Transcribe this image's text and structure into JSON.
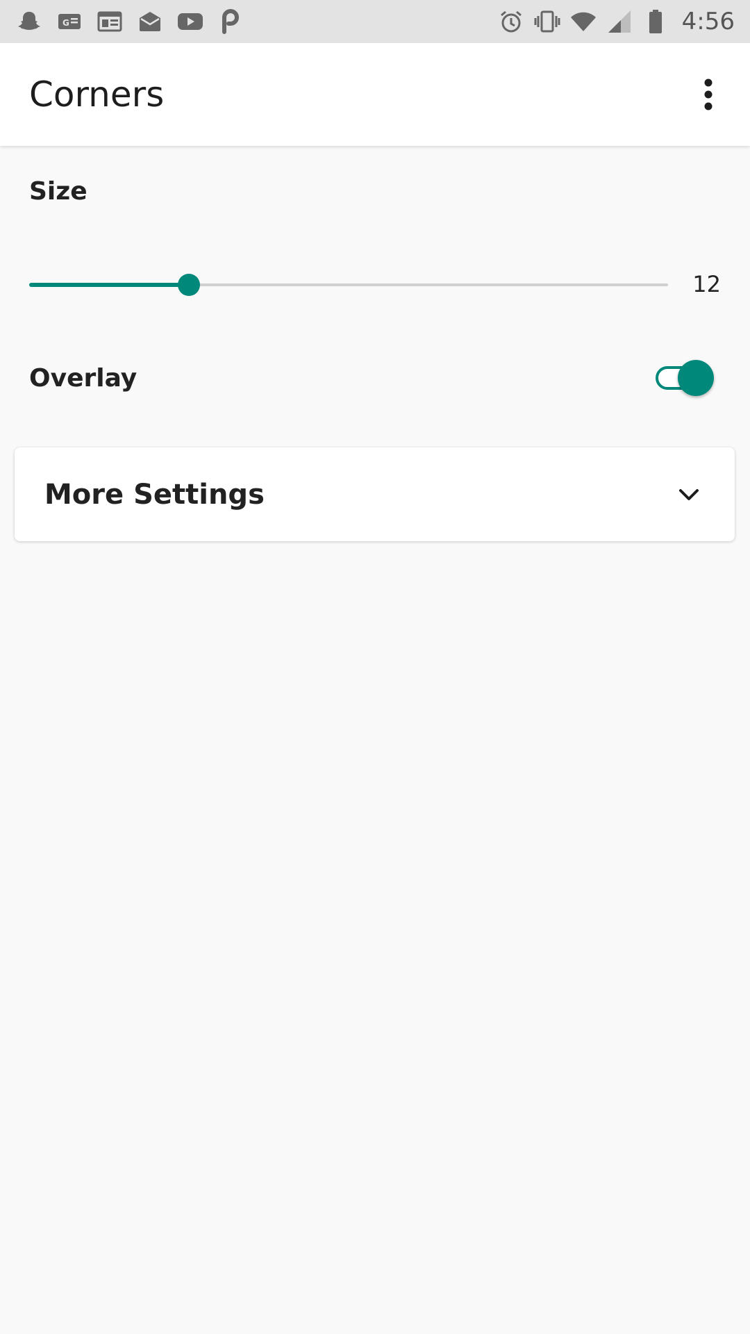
{
  "status_bar": {
    "time": "4:56",
    "left_icons": [
      "snapchat-icon",
      "google-news-icon",
      "newspaper-icon",
      "mail-icon",
      "youtube-icon",
      "p-app-icon"
    ],
    "right_icons": [
      "alarm-icon",
      "vibrate-icon",
      "wifi-icon",
      "signal-icon",
      "battery-icon"
    ]
  },
  "app_bar": {
    "title": "Corners",
    "menu_icon": "more-vert-icon"
  },
  "size": {
    "label": "Size",
    "value": "12",
    "slider_fraction": 0.25
  },
  "overlay": {
    "label": "Overlay",
    "enabled": true
  },
  "more_settings": {
    "label": "More Settings",
    "icon": "chevron-down-icon"
  },
  "colors": {
    "accent": "#00897b",
    "status_bar": "#e3e3e3",
    "background": "#f9f9f9"
  }
}
